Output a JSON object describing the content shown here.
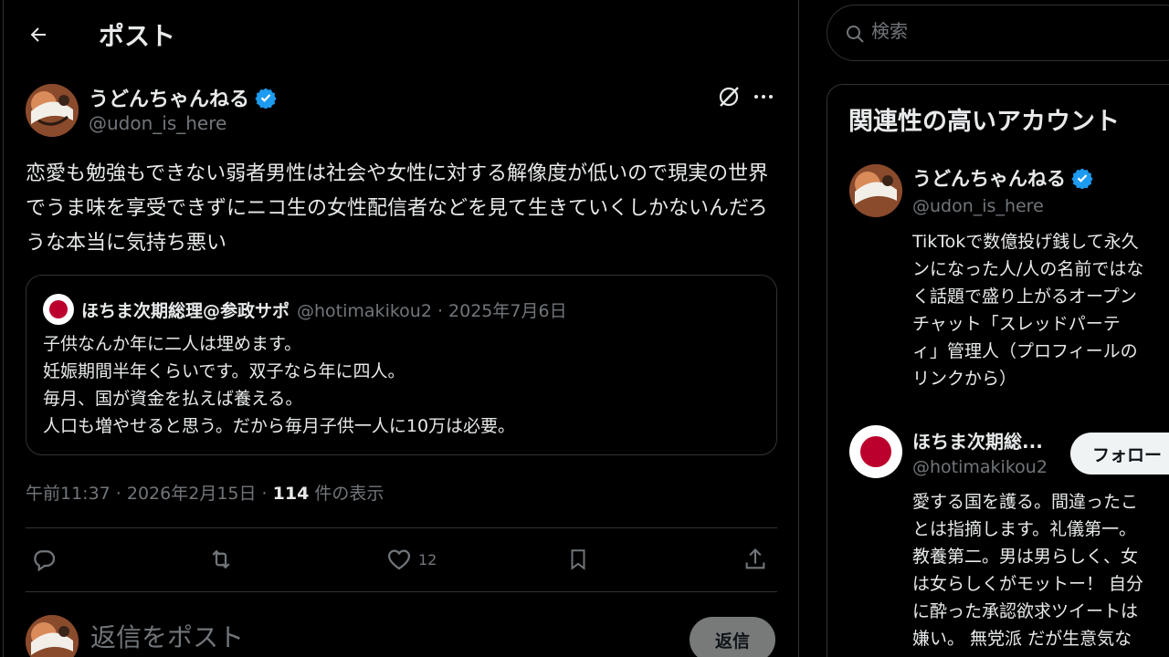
{
  "header": {
    "title": "ポスト"
  },
  "post": {
    "author_name": "うどんちゃんねる",
    "author_handle": "@udon_is_here",
    "text": "恋愛も勉強もできない弱者男性は社会や女性に対する解像度が低いので現実の世界でうま味を享受できずにニコ生の女性配信者などを見て生きていくしかないんだろうな本当に気持ち悪い",
    "quote": {
      "author_name": "ほちま次期総理@参政サポ",
      "meta": "@hotimakikou2 · 2025年7月6日",
      "lines": [
        "子供なんか年に二人は埋めます。",
        "妊娠期間半年くらいです。双子なら年に四人。",
        "毎月、国が資金を払えば養える。",
        "人口も増やせると思う。だから毎月子供一人に10万は必要。"
      ]
    },
    "timestamp": "午前11:37 · 2026年2月15日 · ",
    "views_count": "114",
    "views_label": " 件の表示",
    "likes_count": "12"
  },
  "reply": {
    "placeholder": "返信をポスト",
    "button_label": "返信"
  },
  "search": {
    "placeholder": "検索"
  },
  "sidebar": {
    "title": "関連性の高いアカウント",
    "accounts": [
      {
        "name": "うどんちゃんねる",
        "handle": "@udon_is_here",
        "bio": "TikTokで数億投げ銭して永久\nンになった人/人の名前ではな\nく話題で盛り上がるオープン\nチャット「スレッドパーテ\nィ」管理人（プロフィールの\nリンクから）"
      },
      {
        "name": "ほちま次期総...",
        "handle": "@hotimakikou2",
        "follow_label": "フォロー",
        "bio": "愛する国を護る。間違ったこ\nとは指摘します。礼儀第一。\n教養第二。男は男らしく、女\nは女らしくがモットー！ 自分\nに酔った承認欲求ツイートは\n嫌い。 無党派 だが生意気な"
      }
    ]
  },
  "colors": {
    "background": "#000000",
    "text": "#e7e9ea",
    "muted": "#71767b",
    "border": "#2f3336",
    "verified": "#1d9bf0",
    "flag_red": "#bc002d"
  },
  "icons": [
    "back-arrow-icon",
    "verified-badge-icon",
    "grok-icon",
    "more-icon",
    "reply-icon",
    "repost-icon",
    "like-icon",
    "bookmark-icon",
    "share-icon",
    "search-icon"
  ]
}
